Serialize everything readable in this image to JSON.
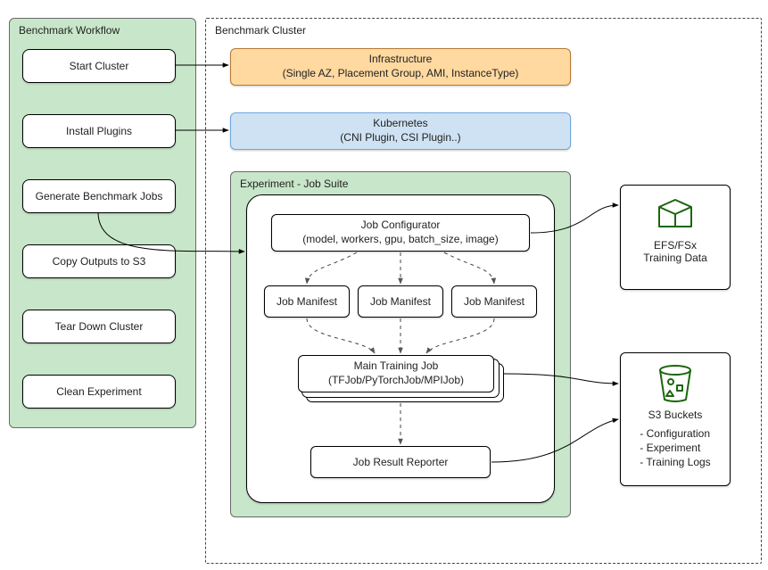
{
  "workflow": {
    "title": "Benchmark Workflow",
    "steps": [
      "Start Cluster",
      "Install Plugins",
      "Generate Benchmark Jobs",
      "Copy Outputs to S3",
      "Tear Down Cluster",
      "Clean Experiment"
    ]
  },
  "cluster": {
    "title": "Benchmark Cluster",
    "infra": {
      "title": "Infrastructure",
      "subtitle": "(Single AZ, Placement Group, AMI, InstanceType)"
    },
    "k8s": {
      "title": "Kubernetes",
      "subtitle": "(CNI Plugin,  CSI Plugin..)"
    },
    "experiment": {
      "title": "Experiment - Job Suite",
      "configurator": {
        "title": "Job Configurator",
        "subtitle": "(model, workers, gpu, batch_size, image)"
      },
      "manifests": [
        "Job Manifest",
        "Job Manifest",
        "Job Manifest"
      ],
      "trainingJob": {
        "title": "Main Training Job",
        "subtitle": "(TFJob/PyTorchJob/MPIJob)"
      },
      "reporter": "Job Result Reporter"
    }
  },
  "storage": {
    "efs": "EFS/FSx\nTraining Data",
    "s3": {
      "title": "S3 Buckets",
      "items": [
        "- Configuration",
        "- Experiment",
        "- Training Logs"
      ]
    }
  }
}
